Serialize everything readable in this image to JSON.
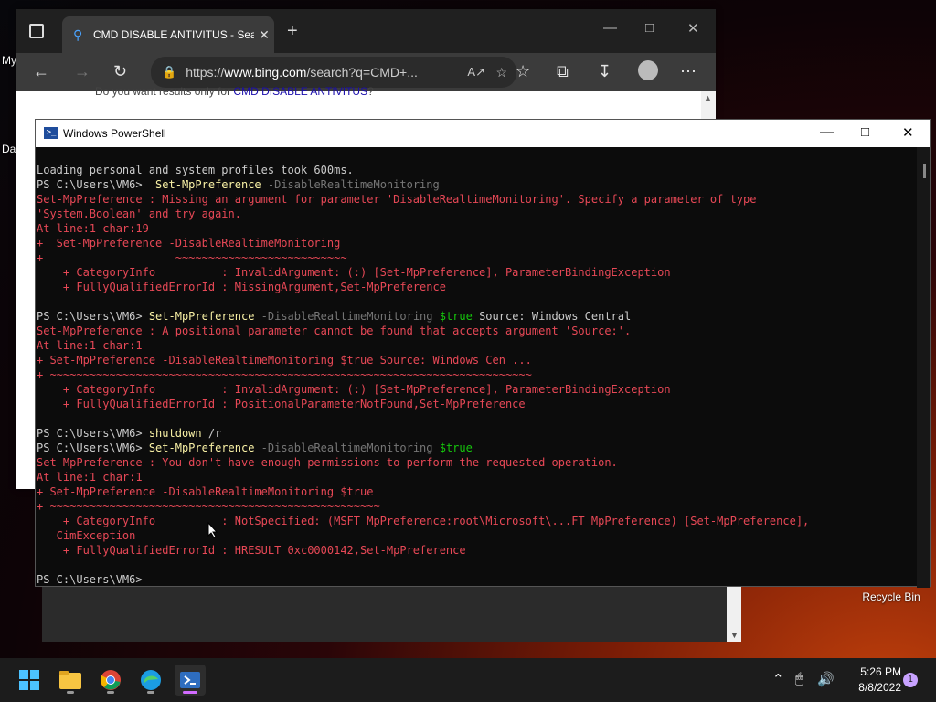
{
  "desktop": {
    "label_my": "My",
    "label_da": "Da",
    "recycle_bin": "Recycle Bin"
  },
  "browser": {
    "tab_title": "CMD DISABLE ANTIVITUS - Sear",
    "url_prefix": "https://",
    "url_domain": "www.bing.com",
    "url_rest": "/search?q=CMD+...",
    "did_you_mean_prefix": "Do you want results only for ",
    "did_you_mean_link": "CMD DISABLE ANTIVITUS",
    "did_you_mean_suffix": "?"
  },
  "powershell": {
    "title": "Windows PowerShell",
    "lines": [
      [
        {
          "t": "Loading personal and system profiles took 600ms.",
          "c": "default"
        }
      ],
      [
        {
          "t": "PS C:\\Users\\VM6> ",
          "c": "default"
        },
        {
          "t": " Set-MpPreference",
          "c": "cmd"
        },
        {
          "t": " -DisableRealtimeMonitoring",
          "c": "param"
        }
      ],
      [
        {
          "t": "Set-MpPreference : Missing an argument for parameter 'DisableRealtimeMonitoring'. Specify a parameter of type",
          "c": "error"
        }
      ],
      [
        {
          "t": "'System.Boolean' and try again.",
          "c": "error"
        }
      ],
      [
        {
          "t": "At line:1 char:19",
          "c": "error"
        }
      ],
      [
        {
          "t": "+  Set-MpPreference -DisableRealtimeMonitoring",
          "c": "error"
        }
      ],
      [
        {
          "t": "+                    ~~~~~~~~~~~~~~~~~~~~~~~~~~",
          "c": "error"
        }
      ],
      [
        {
          "t": "    + CategoryInfo          : InvalidArgument: (:) [Set-MpPreference], ParameterBindingException",
          "c": "error"
        }
      ],
      [
        {
          "t": "    + FullyQualifiedErrorId : MissingArgument,Set-MpPreference",
          "c": "error"
        }
      ],
      [
        {
          "t": "",
          "c": "default"
        }
      ],
      [
        {
          "t": "PS C:\\Users\\VM6> ",
          "c": "default"
        },
        {
          "t": "Set-MpPreference",
          "c": "cmd"
        },
        {
          "t": " -DisableRealtimeMonitoring ",
          "c": "param"
        },
        {
          "t": "$true",
          "c": "var"
        },
        {
          "t": " Source: Windows Central",
          "c": "default"
        }
      ],
      [
        {
          "t": "Set-MpPreference : A positional parameter cannot be found that accepts argument 'Source:'.",
          "c": "error"
        }
      ],
      [
        {
          "t": "At line:1 char:1",
          "c": "error"
        }
      ],
      [
        {
          "t": "+ Set-MpPreference -DisableRealtimeMonitoring $true Source: Windows Cen ...",
          "c": "error"
        }
      ],
      [
        {
          "t": "+ ~~~~~~~~~~~~~~~~~~~~~~~~~~~~~~~~~~~~~~~~~~~~~~~~~~~~~~~~~~~~~~~~~~~~~~~~~",
          "c": "error"
        }
      ],
      [
        {
          "t": "    + CategoryInfo          : InvalidArgument: (:) [Set-MpPreference], ParameterBindingException",
          "c": "error"
        }
      ],
      [
        {
          "t": "    + FullyQualifiedErrorId : PositionalParameterNotFound,Set-MpPreference",
          "c": "error"
        }
      ],
      [
        {
          "t": "",
          "c": "default"
        }
      ],
      [
        {
          "t": "PS C:\\Users\\VM6> ",
          "c": "default"
        },
        {
          "t": "shutdown",
          "c": "cmd"
        },
        {
          "t": " /r",
          "c": "default"
        }
      ],
      [
        {
          "t": "PS C:\\Users\\VM6> ",
          "c": "default"
        },
        {
          "t": "Set-MpPreference",
          "c": "cmd"
        },
        {
          "t": " -DisableRealtimeMonitoring ",
          "c": "param"
        },
        {
          "t": "$true",
          "c": "var"
        }
      ],
      [
        {
          "t": "Set-MpPreference : You don't have enough permissions to perform the requested operation.",
          "c": "error"
        }
      ],
      [
        {
          "t": "At line:1 char:1",
          "c": "error"
        }
      ],
      [
        {
          "t": "+ Set-MpPreference -DisableRealtimeMonitoring $true",
          "c": "error"
        }
      ],
      [
        {
          "t": "+ ~~~~~~~~~~~~~~~~~~~~~~~~~~~~~~~~~~~~~~~~~~~~~~~~~~",
          "c": "error"
        }
      ],
      [
        {
          "t": "    + CategoryInfo          : NotSpecified: (MSFT_MpPreference:root\\Microsoft\\...FT_MpPreference) [Set-MpPreference],",
          "c": "error"
        }
      ],
      [
        {
          "t": "   CimException",
          "c": "error"
        }
      ],
      [
        {
          "t": "    + FullyQualifiedErrorId : HRESULT 0xc0000142,Set-MpPreference",
          "c": "error"
        }
      ],
      [
        {
          "t": "",
          "c": "default"
        }
      ],
      [
        {
          "t": "PS C:\\Users\\VM6> ",
          "c": "default"
        }
      ]
    ]
  },
  "taskbar": {
    "time": "5:26 PM",
    "date": "8/8/2022",
    "notification_count": "1",
    "apps": [
      "start-icon",
      "file-explorer-icon",
      "chrome-icon",
      "edge-icon",
      "powershell-icon"
    ]
  },
  "colors": {
    "error": "#e74856",
    "cmd": "#f9f1a5",
    "param": "#767676",
    "var": "#16c60c",
    "default": "#cccccc",
    "accent": "#d26bff"
  }
}
